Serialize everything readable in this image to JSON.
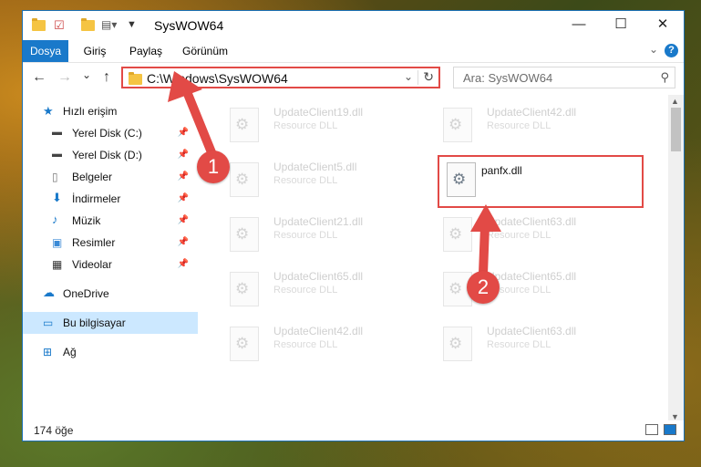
{
  "window": {
    "title": "SysWOW64",
    "controls": {
      "minimize": "—",
      "maximize": "☐",
      "close": "✕"
    }
  },
  "ribbon": {
    "tabs": [
      "Dosya",
      "Giriş",
      "Paylaş",
      "Görünüm"
    ],
    "help": "?"
  },
  "nav": {
    "back": "←",
    "forward": "→",
    "recent": "⌄",
    "up": "↑",
    "address": "C:\\Windows\\SysWOW64",
    "search_placeholder": "Ara: SysWOW64"
  },
  "sidebar": {
    "items": [
      {
        "label": "Hızlı erişim",
        "icon": "star-icon",
        "pinned": false
      },
      {
        "label": "Yerel Disk (C:)",
        "icon": "drive-icon",
        "pinned": true
      },
      {
        "label": "Yerel Disk (D:)",
        "icon": "drive-icon",
        "pinned": true
      },
      {
        "label": "Belgeler",
        "icon": "documents-icon",
        "pinned": true
      },
      {
        "label": "İndirmeler",
        "icon": "download-icon",
        "pinned": true
      },
      {
        "label": "Müzik",
        "icon": "music-icon",
        "pinned": true
      },
      {
        "label": "Resimler",
        "icon": "pictures-icon",
        "pinned": true
      },
      {
        "label": "Videolar",
        "icon": "videos-icon",
        "pinned": true
      },
      {
        "label": "OneDrive",
        "icon": "cloud-icon",
        "pinned": false
      },
      {
        "label": "Bu bilgisayar",
        "icon": "computer-icon",
        "pinned": false,
        "selected": true
      },
      {
        "label": "Ağ",
        "icon": "network-icon",
        "pinned": false
      }
    ]
  },
  "files": [
    {
      "name": "UpdateClient19.dll",
      "type": "Resource DLL"
    },
    {
      "name": "UpdateClient42.dll",
      "type": "Resource DLL"
    },
    {
      "name": "UpdateClient5.dll",
      "type": "Resource DLL"
    },
    {
      "name": "panfx.dll",
      "type": "",
      "highlighted": true
    },
    {
      "name": "UpdateClient21.dll",
      "type": "Resource DLL"
    },
    {
      "name": "UpdateClient63.dll",
      "type": "Resource DLL"
    },
    {
      "name": "UpdateClient65.dll",
      "type": "Resource DLL"
    },
    {
      "name": "UpdateClient65.dll",
      "type": "Resource DLL"
    },
    {
      "name": "UpdateClient42.dll",
      "type": "Resource DLL"
    },
    {
      "name": "UpdateClient63.dll",
      "type": "Resource DLL"
    }
  ],
  "status": {
    "count": "174 öğe"
  },
  "annotations": [
    {
      "number": "1"
    },
    {
      "number": "2"
    }
  ],
  "colors": {
    "accent": "#1979ca",
    "highlight": "#e24a46",
    "selected_bg": "#cce8ff"
  }
}
